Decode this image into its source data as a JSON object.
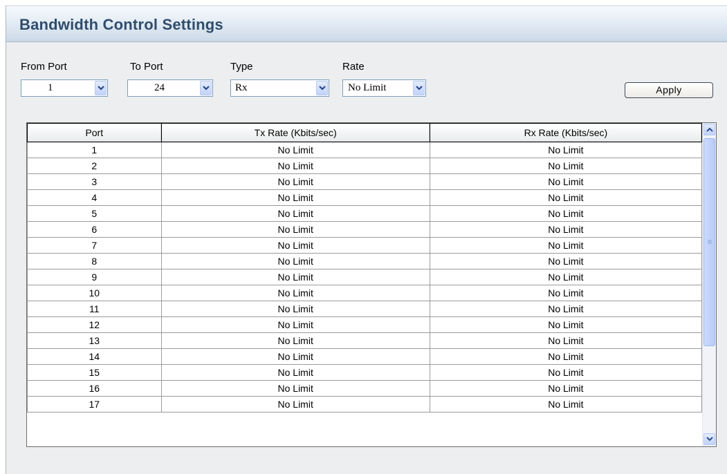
{
  "panel": {
    "title": "Bandwidth Control Settings"
  },
  "form": {
    "from_port": {
      "label": "From Port",
      "value": "1"
    },
    "to_port": {
      "label": "To Port",
      "value": "24"
    },
    "type": {
      "label": "Type",
      "value": "Rx"
    },
    "rate": {
      "label": "Rate",
      "value": "No Limit"
    },
    "apply_label": "Apply"
  },
  "table": {
    "headers": [
      "Port",
      "Tx Rate (Kbits/sec)",
      "Rx Rate (Kbits/sec)"
    ],
    "rows": [
      [
        "1",
        "No Limit",
        "No Limit"
      ],
      [
        "2",
        "No Limit",
        "No Limit"
      ],
      [
        "3",
        "No Limit",
        "No Limit"
      ],
      [
        "4",
        "No Limit",
        "No Limit"
      ],
      [
        "5",
        "No Limit",
        "No Limit"
      ],
      [
        "6",
        "No Limit",
        "No Limit"
      ],
      [
        "7",
        "No Limit",
        "No Limit"
      ],
      [
        "8",
        "No Limit",
        "No Limit"
      ],
      [
        "9",
        "No Limit",
        "No Limit"
      ],
      [
        "10",
        "No Limit",
        "No Limit"
      ],
      [
        "11",
        "No Limit",
        "No Limit"
      ],
      [
        "12",
        "No Limit",
        "No Limit"
      ],
      [
        "13",
        "No Limit",
        "No Limit"
      ],
      [
        "14",
        "No Limit",
        "No Limit"
      ],
      [
        "15",
        "No Limit",
        "No Limit"
      ],
      [
        "16",
        "No Limit",
        "No Limit"
      ],
      [
        "17",
        "No Limit",
        "No Limit"
      ]
    ]
  },
  "icons": {
    "dropdown": "chevron-down-icon",
    "scroll_up": "arrow-up-icon",
    "scroll_down": "arrow-down-icon"
  },
  "colors": {
    "title": "#2f4d6c",
    "panel_bg": "#eceef0",
    "control_blue": "#c2d3fa"
  }
}
